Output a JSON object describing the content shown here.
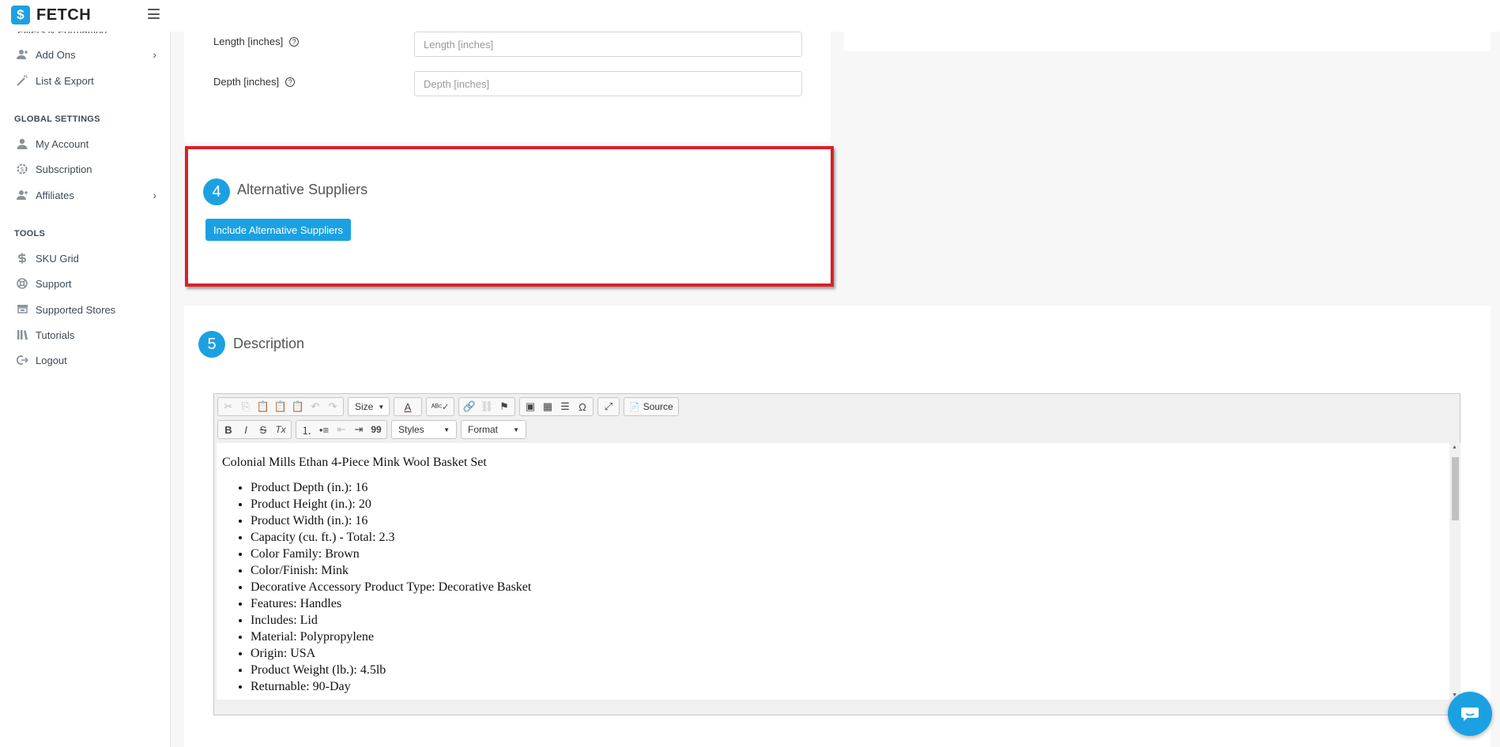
{
  "app": {
    "logo_mark": "$",
    "logo_text": "FETCH"
  },
  "sidebar": {
    "cut_item": "Filters & Formatting",
    "items_top": [
      {
        "label": "Add Ons",
        "icon": "user-plus-icon",
        "chevron": "›"
      },
      {
        "label": "List & Export",
        "icon": "magic-wand-icon"
      }
    ],
    "global_heading": "GLOBAL SETTINGS",
    "items_global": [
      {
        "label": "My Account",
        "icon": "user-icon"
      },
      {
        "label": "Subscription",
        "icon": "subscription-icon"
      },
      {
        "label": "Affiliates",
        "icon": "user-plus-icon",
        "chevron": "›"
      }
    ],
    "tools_heading": "TOOLS",
    "items_tools": [
      {
        "label": "SKU Grid",
        "icon": "dollar-icon"
      },
      {
        "label": "Support",
        "icon": "lifebuoy-icon"
      },
      {
        "label": "Supported Stores",
        "icon": "truck-icon"
      },
      {
        "label": "Tutorials",
        "icon": "books-icon"
      },
      {
        "label": "Logout",
        "icon": "logout-icon"
      }
    ]
  },
  "dimensions": {
    "length_label": "Length [inches]",
    "length_placeholder": "Length [inches]",
    "length_value": "",
    "depth_label": "Depth [inches]",
    "depth_placeholder": "Depth [inches]",
    "depth_value": "",
    "help_glyph": "?"
  },
  "suppliers": {
    "step": "4",
    "title": "Alternative Suppliers",
    "button_label": "Include Alternative Suppliers"
  },
  "description": {
    "step": "5",
    "title": "Description",
    "toolbar": {
      "size_label": "Size",
      "styles_label": "Styles",
      "format_label": "Format",
      "source_label": "Source",
      "font_color_glyph": "A",
      "bold_glyph": "B",
      "italic_glyph": "I",
      "strike_glyph": "S",
      "clear_format_glyph": "Tx",
      "blockquote_glyph": "99",
      "special_char_glyph": "Ω"
    },
    "content": {
      "heading": "Colonial Mills Ethan 4-Piece Mink Wool Basket Set",
      "bullets": [
        "Product Depth (in.): 16",
        "Product Height (in.): 20",
        "Product Width (in.): 16",
        "Capacity (cu. ft.) - Total: 2.3",
        "Color Family: Brown",
        "Color/Finish: Mink",
        "Decorative Accessory Product Type: Decorative Basket",
        "Features: Handles",
        "Includes: Lid",
        "Material: Polypropylene",
        "Origin: USA",
        "Product Weight (lb.): 4.5lb",
        "Returnable: 90-Day"
      ]
    }
  },
  "colors": {
    "accent": "#1ba1e2",
    "highlight_border": "#d9202a"
  }
}
